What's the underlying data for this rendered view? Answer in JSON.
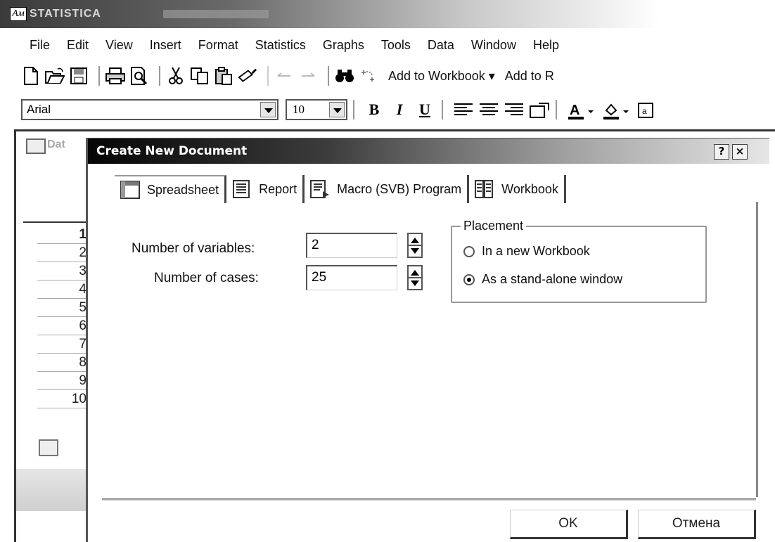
{
  "app": {
    "logo": "Ам",
    "title": "STATISTICA"
  },
  "menu": [
    "File",
    "Edit",
    "View",
    "Insert",
    "Format",
    "Statistics",
    "Graphs",
    "Tools",
    "Data",
    "Window",
    "Help"
  ],
  "toolbar": {
    "add_workbook_label": "Add to Workbook ▾",
    "add_report_label": "Add to R"
  },
  "format_toolbar": {
    "font": "Arial",
    "size": "10",
    "bold": "B",
    "italic": "I",
    "underline": "U",
    "font_color_glyph": "A"
  },
  "background_window": {
    "title": "Dat",
    "row_numbers": [
      "1",
      "2",
      "3",
      "4",
      "5",
      "6",
      "7",
      "8",
      "9",
      "10"
    ]
  },
  "dialog": {
    "title": "Create New Document",
    "help": "?",
    "close": "×",
    "tabs": [
      {
        "label": "Spreadsheet",
        "icon": "spreadsheet-icon"
      },
      {
        "label": "Report",
        "icon": "report-icon"
      },
      {
        "label": "Macro (SVB) Program",
        "icon": "macro-icon"
      },
      {
        "label": "Workbook",
        "icon": "workbook-icon"
      }
    ],
    "variables_label": "Number of variables:",
    "variables_value": "2",
    "cases_label": "Number of cases:",
    "cases_value": "25",
    "placement": {
      "legend": "Placement",
      "option_new_workbook": "In a new Workbook",
      "option_standalone": "As a stand-alone window",
      "selected": "As a stand-alone window"
    },
    "ok_label": "OK",
    "cancel_label": "Отмена"
  }
}
